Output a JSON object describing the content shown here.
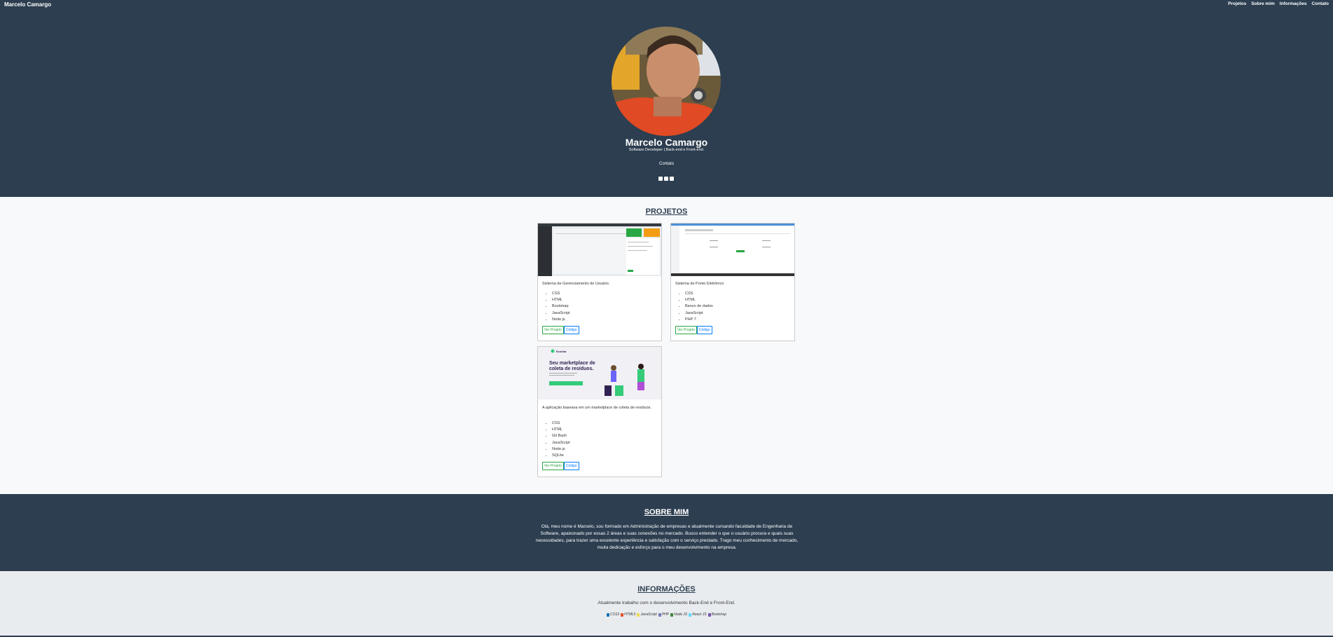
{
  "nav": {
    "brand": "Marcelo Camargo",
    "links": [
      "Projetos",
      "Sobre mim",
      "Informações",
      "Contato"
    ]
  },
  "hero": {
    "name": "Marcelo Camargo",
    "subtitle": "Software Developer | Back-end e Front-end.",
    "contact": "Contato",
    "social_icons": [
      "linkedin-icon",
      "github-icon",
      "instagram-icon"
    ]
  },
  "projects": {
    "title": "PROJETOS",
    "cards": [
      {
        "title": "Sistema de Gerenciamento de Usuário.",
        "tags": [
          "CSS",
          "HTML",
          "Bootstrap",
          "JavaScript",
          "Node.js"
        ],
        "view_label": "Ver Projeto",
        "code_label": "Código"
      },
      {
        "title": "Sistema de Ponto Eletrônico",
        "tags": [
          "CSS",
          "HTML",
          "Banco de dados",
          "JavaScript",
          "PHP 7"
        ],
        "view_label": "Ver Projeto",
        "code_label": "Código"
      },
      {
        "title": "A aplicação baseava em um marketplace de coleta de resíduos.",
        "tags": [
          "CSS",
          "HTML",
          "Git Bash",
          "JavaScript",
          "Node.js",
          "SQLite"
        ],
        "view_label": "Ver Projeto",
        "code_label": "Código",
        "thumb_logo": "Ecoleta",
        "thumb_headline": "Seu marketplace de coleta de resíduos."
      }
    ]
  },
  "about": {
    "title": "SOBRE MIM",
    "text": "Olá, meu nome é Marcelo, sou formado em Administração de empresas e atualmente cursando faculdade de Engenharia de Software, apaixonado por essas 2 áreas e suas conexões no mercado. Busco entender o que o usuário procura e quais suas necessidades, para trazer uma excelente experiência e satisfação com o serviço prestado. Trago meu conhecimento de mercado, muita dedicação e esforço para o meu desenvolvimento na empresa."
  },
  "info": {
    "title": "INFORMAÇÕES",
    "text": "Atualmente trabalho com o desenvolvimento Back-End e Front-End.",
    "techs": [
      {
        "label": "CSS3",
        "color": "#1572b6"
      },
      {
        "label": "HTML5",
        "color": "#e34f26"
      },
      {
        "label": "JavaScript",
        "color": "#f0db4f"
      },
      {
        "label": "PHP",
        "color": "#777bb4"
      },
      {
        "label": "Node JS",
        "color": "#3c873a"
      },
      {
        "label": "React JS",
        "color": "#61dafb"
      },
      {
        "label": "Bootstrap",
        "color": "#7952b3"
      }
    ]
  },
  "colors": {
    "dark": "#2c3e50",
    "light": "#f8f9fa",
    "info_bg": "#e9ecef",
    "btn_green": "#28a745",
    "btn_blue": "#007bff"
  }
}
